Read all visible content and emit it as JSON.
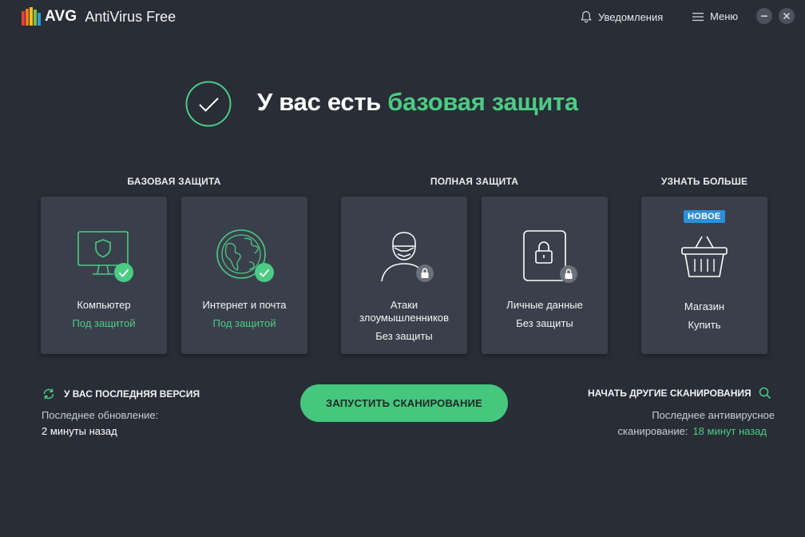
{
  "app": {
    "brand": "AVG",
    "product": "AntiVirus Free"
  },
  "titlebar": {
    "notifications_label": "Уведомления",
    "menu_label": "Меню"
  },
  "status": {
    "prefix": "У вас есть ",
    "highlight": "базовая защита"
  },
  "sections": {
    "basic": "БАЗОВАЯ ЗАЩИТА",
    "full": "ПОЛНАЯ ЗАЩИТА",
    "more": "УЗНАТЬ БОЛЬШЕ"
  },
  "cards": [
    {
      "title": "Компьютер",
      "status": "Под защитой",
      "icon": "monitor-shield-icon"
    },
    {
      "title": "Интернет и почта",
      "status": "Под защитой",
      "icon": "globe-icon"
    },
    {
      "title": "Атаки\nзлоумышленников",
      "title_line1": "Атаки",
      "title_line2": "злоумышленников",
      "status": "Без защиты",
      "icon": "hacker-icon"
    },
    {
      "title": "Личные данные",
      "status": "Без защиты",
      "icon": "lock-document-icon"
    },
    {
      "title": "Магазин",
      "status": "Купить",
      "badge": "НОВОЕ",
      "icon": "basket-icon"
    }
  ],
  "update": {
    "label": "У ВАС ПОСЛЕДНЯЯ ВЕРСИЯ",
    "last_update_label": "Последнее обновление:",
    "last_update_value": "2 минуты назад"
  },
  "scan_button": "ЗАПУСТИТЬ СКАНИРОВАНИЕ",
  "other_scans": {
    "label": "НАЧАТЬ ДРУГИЕ СКАНИРОВАНИЯ",
    "last_scan_line1": "Последнее антивирусное",
    "last_scan_line2": "сканирование:",
    "last_scan_value": "18 минут назад"
  },
  "colors": {
    "accent_green": "#4ccb84",
    "background": "#282d36",
    "card": "#3a404b",
    "badge_blue": "#2c8fd8"
  }
}
